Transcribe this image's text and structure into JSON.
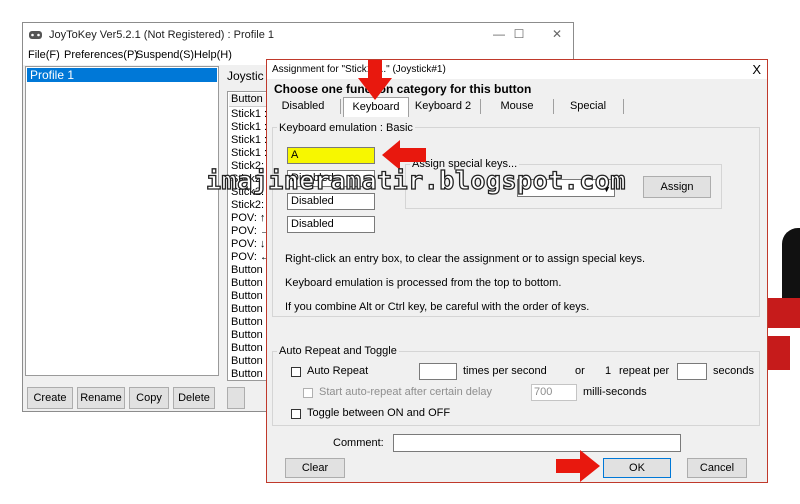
{
  "watermark": "imajineramatir.blogspot.com",
  "main_window": {
    "title": "JoyToKey Ver5.2.1 (Not Registered) : Profile 1",
    "window_controls": [
      "—",
      "☐",
      "✕"
    ],
    "menu": [
      "File(F)",
      "Preferences(P)",
      "Suspend(S)",
      "Help(H)"
    ],
    "profiles": [
      "Profile 1"
    ],
    "profile_buttons": [
      "Create",
      "Rename",
      "Copy",
      "Delete"
    ],
    "joystick_tab": "Joystic",
    "button_column_header": "Button",
    "button_rows": [
      "Stick1 :",
      "Stick1 :",
      "Stick1 :",
      "Stick1 :",
      "Stick2:",
      "Stick2:",
      "Stick2:",
      "Stick2:",
      "POV: ↑",
      "POV: →",
      "POV: ↓",
      "POV: ←",
      "Button",
      "Button",
      "Button",
      "Button",
      "Button",
      "Button",
      "Button",
      "Button",
      "Button"
    ]
  },
  "dialog": {
    "title": "Assignment for \"Stick1: ...\" (Joystick#1)",
    "close_glyph": "X",
    "heading": "Choose one function category for this button",
    "tabs": [
      "Disabled",
      "Keyboard",
      "Keyboard 2",
      "Mouse",
      "Special"
    ],
    "selected_tab": "Keyboard",
    "keyboard_group_label": "Keyboard emulation : Basic",
    "key_entries": [
      "A",
      "Disabled",
      "Disabled",
      "Disabled"
    ],
    "special_keys_label": "Assign special keys...",
    "special_keys_value": "",
    "assign_button": "Assign",
    "help_lines": [
      "Right-click an entry box, to clear the assignment or to assign special keys.",
      "Keyboard emulation is processed from the top to bottom.",
      "If you combine Alt or Ctrl key, be careful with the order of keys."
    ],
    "auto_repeat_group_label": "Auto Repeat and Toggle",
    "auto_repeat_label": "Auto Repeat",
    "auto_repeat_checked": false,
    "times_per_second_label": "times per second",
    "or_label": "or",
    "one_label": "1",
    "repeat_per_label": "repeat per",
    "seconds_label": "seconds",
    "start_delay_label": "Start auto-repeat after certain delay",
    "delay_value": "700",
    "milliseconds_label": "milli-seconds",
    "toggle_label": "Toggle between ON and OFF",
    "toggle_checked": false,
    "comment_label": "Comment:",
    "comment_value": "",
    "clear_button": "Clear",
    "ok_button": "OK",
    "cancel_button": "Cancel"
  },
  "colors": {
    "arrow": "#e8180e",
    "selection": "#0078d7",
    "key_entry_highlight": "#f7f700"
  }
}
